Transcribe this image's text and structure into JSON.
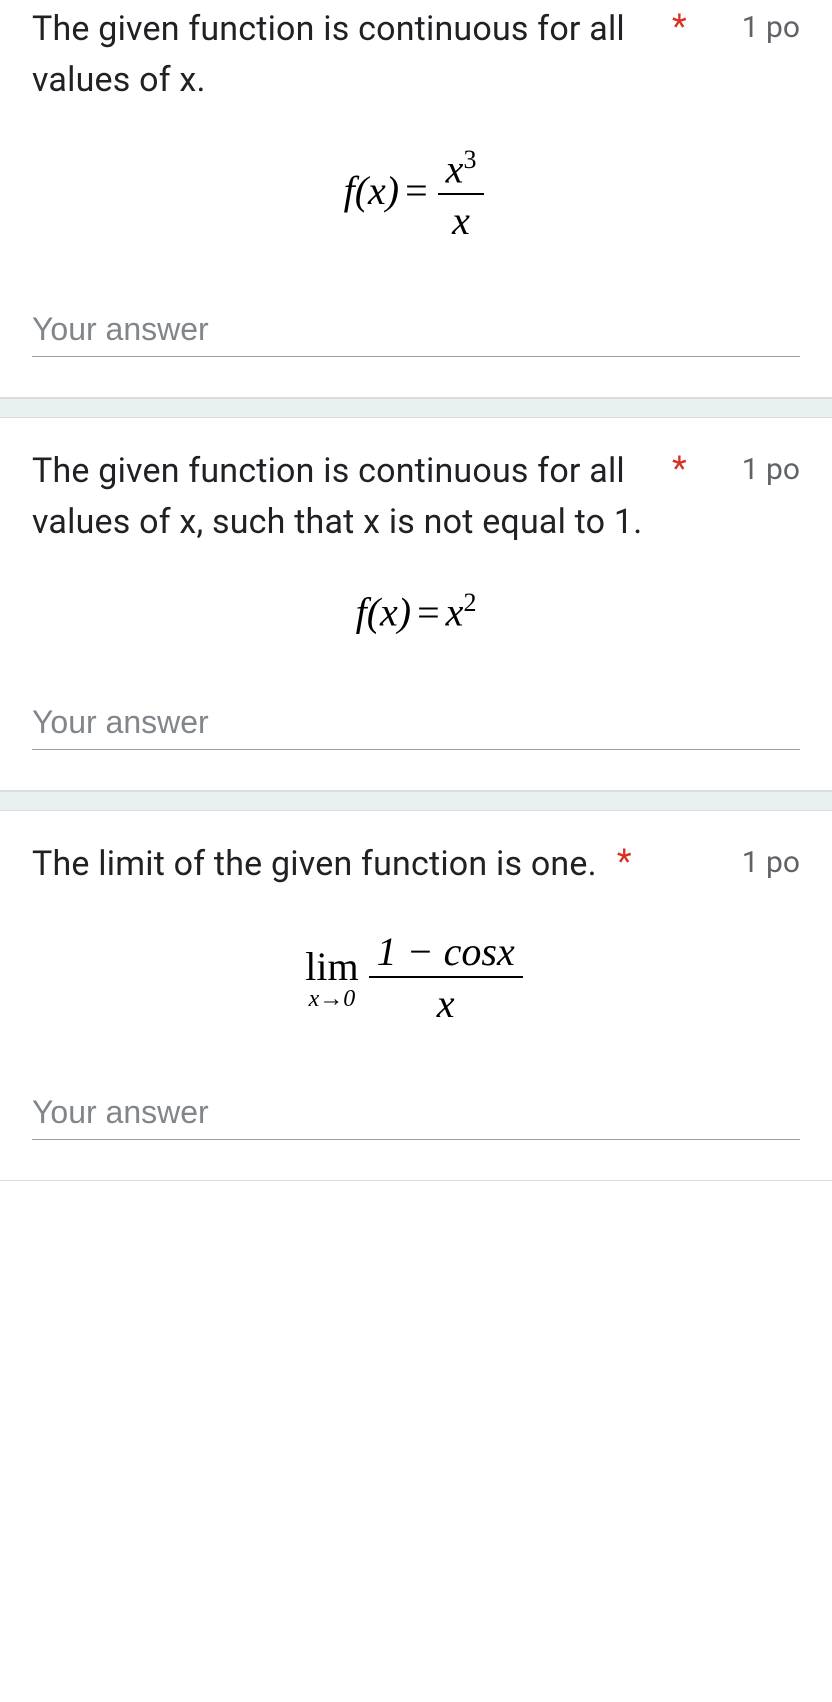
{
  "questions": [
    {
      "text": "The given function is continuous for all values of x.",
      "required_mark": "*",
      "points": "1 po",
      "formula_html": "<span class='fn'>f</span>(<span class='fn'>x</span>)<span class='op'>=</span><span class='frac'><span class='num'><span class='fn'>x</span><span class='sup'>3</span></span><span class='den'><span class='fn'>x</span></span></span>",
      "answer_placeholder": "Your answer"
    },
    {
      "text": "The given function is continuous for all values of x, such that x is not equal to 1.",
      "required_mark": "*",
      "points": "1 po",
      "formula_html": "<span class='fn'>f</span>(<span class='fn'>x</span>)<span class='op'>=</span><span class='fn'>x</span><span class='sup'>2</span>",
      "answer_placeholder": "Your answer"
    },
    {
      "text": "The limit of the given function is one.",
      "required_mark": "*",
      "points": "1 po",
      "formula_html": "<span class='lim-block'><span class='lim-top'>lim</span><span class='lim-sub'>x→0</span></span><span class='frac'><span class='num'>1 − <span class='fn'>cosx</span></span><span class='den'><span class='fn'>x</span></span></span>",
      "answer_placeholder": "Your answer"
    }
  ]
}
